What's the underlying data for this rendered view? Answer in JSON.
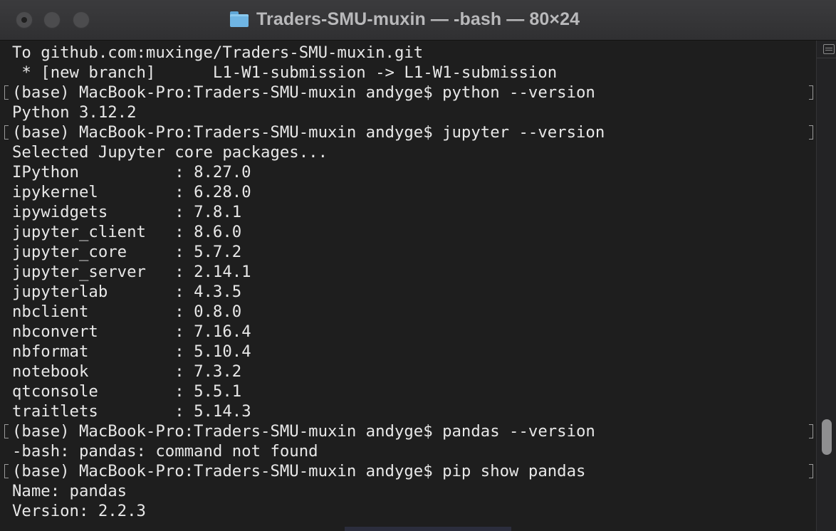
{
  "window": {
    "title": "Traders-SMU-muxin — -bash — 80×24",
    "folder_icon": "folder-icon",
    "buttons": [
      "close",
      "minimize",
      "zoom"
    ]
  },
  "terminal": {
    "prompt": "(base) MacBook-Pro:Traders-SMU-muxin andyge$ ",
    "git_output": [
      "To github.com:muxinge/Traders-SMU-muxin.git",
      " * [new branch]      L1-W1-submission -> L1-W1-submission"
    ],
    "commands": {
      "python": "python --version",
      "jupyter": "jupyter --version",
      "pandas": "pandas --version",
      "pip": "pip show pandas"
    },
    "python_version_output": "Python 3.12.2",
    "jupyter_header": "Selected Jupyter core packages...",
    "packages": [
      {
        "name": "IPython",
        "version": "8.27.0"
      },
      {
        "name": "ipykernel",
        "version": "6.28.0"
      },
      {
        "name": "ipywidgets",
        "version": "7.8.1"
      },
      {
        "name": "jupyter_client",
        "version": "8.6.0"
      },
      {
        "name": "jupyter_core",
        "version": "5.7.2"
      },
      {
        "name": "jupyter_server",
        "version": "2.14.1"
      },
      {
        "name": "jupyterlab",
        "version": "4.3.5"
      },
      {
        "name": "nbclient",
        "version": "0.8.0"
      },
      {
        "name": "nbconvert",
        "version": "7.16.4"
      },
      {
        "name": "nbformat",
        "version": "5.10.4"
      },
      {
        "name": "notebook",
        "version": "7.3.2"
      },
      {
        "name": "qtconsole",
        "version": "5.5.1"
      },
      {
        "name": "traitlets",
        "version": "5.14.3"
      }
    ],
    "pandas_error": "-bash: pandas: command not found",
    "pip_output": [
      "Name: pandas",
      "Version: 2.2.3"
    ]
  },
  "colors": {
    "background": "#1e1e1e",
    "text": "#e8e8e8",
    "title_text": "#b9b9bb",
    "folder": "#6fb5e3"
  },
  "scrollbar": {
    "icon": "split-pane-icon"
  }
}
